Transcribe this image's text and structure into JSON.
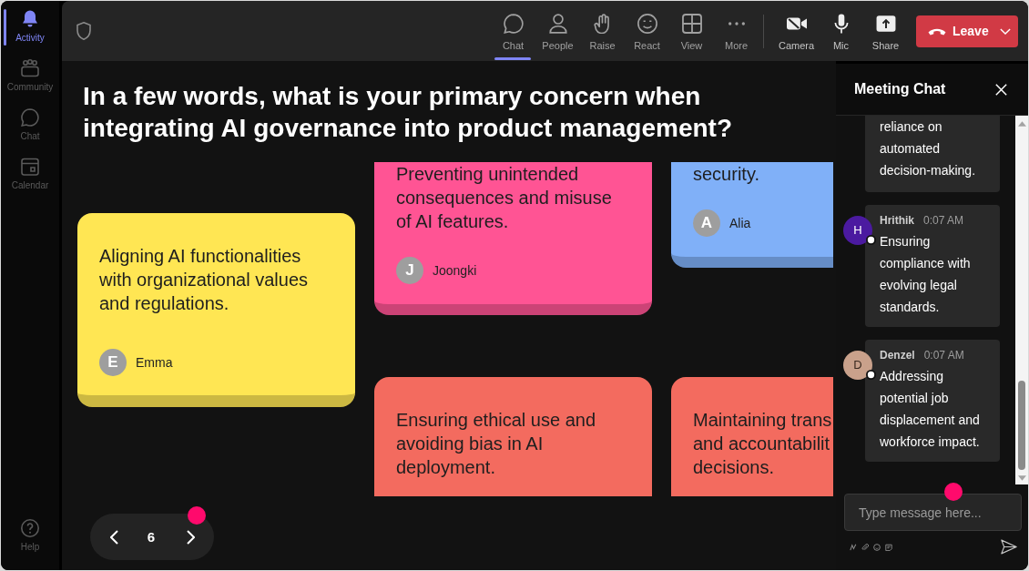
{
  "sidebar": {
    "items": [
      {
        "label": "Activity",
        "selected": true
      },
      {
        "label": "Community",
        "selected": false
      },
      {
        "label": "Chat",
        "selected": false
      },
      {
        "label": "Calendar",
        "selected": false
      }
    ],
    "help": {
      "label": "Help"
    }
  },
  "toolbar": {
    "meeting_controls": [
      {
        "label": "Chat",
        "selected": true
      },
      {
        "label": "People",
        "selected": false
      },
      {
        "label": "Raise",
        "selected": false
      },
      {
        "label": "React",
        "selected": false
      },
      {
        "label": "View",
        "selected": false
      },
      {
        "label": "More",
        "selected": false
      }
    ],
    "device_controls": [
      {
        "label": "Camera"
      },
      {
        "label": "Mic"
      },
      {
        "label": "Share"
      }
    ],
    "leave_button": {
      "label": "Leave"
    }
  },
  "question": "In a few words, what is your primary concern when integrating AI governance into product management?",
  "board": {
    "columns": [
      {
        "cards": [
          {
            "color": "#ffe653",
            "text": "Aligning AI functionalities with organizational values and regulations.",
            "author": {
              "initial": "E",
              "name": "Emma"
            }
          }
        ]
      },
      {
        "cards": [
          {
            "color": "#ff5494",
            "text": "Preventing unintended consequences and misuse of AI features.",
            "author": {
              "initial": "J",
              "name": "Joongki"
            }
          },
          {
            "color": "#f36b5f",
            "text": "Ensuring ethical use and avoiding bias in AI deployment."
          }
        ]
      },
      {
        "cards": [
          {
            "color": "#80b0f8",
            "text": "security.",
            "author": {
              "initial": "A",
              "name": "Alia"
            }
          },
          {
            "color": "#f36b5f",
            "text": "Maintaining trans\nand accountabilit\ndecisions."
          }
        ]
      }
    ]
  },
  "pager": {
    "page": "6"
  },
  "chat": {
    "title": "Meeting Chat",
    "messages": [
      {
        "text": "reliance on automated decision-making."
      },
      {
        "author": "Hrithik",
        "time": "0:07 AM",
        "initial": "H",
        "color": "#4b1aa0",
        "text": "Ensuring compliance with evolving legal standards."
      },
      {
        "author": "Denzel",
        "time": "0:07 AM",
        "initial": "D",
        "color": "#c9a18b",
        "text": "Addressing potential job displacement and workforce impact."
      }
    ],
    "composer": {
      "placeholder": "Type message here..."
    }
  }
}
